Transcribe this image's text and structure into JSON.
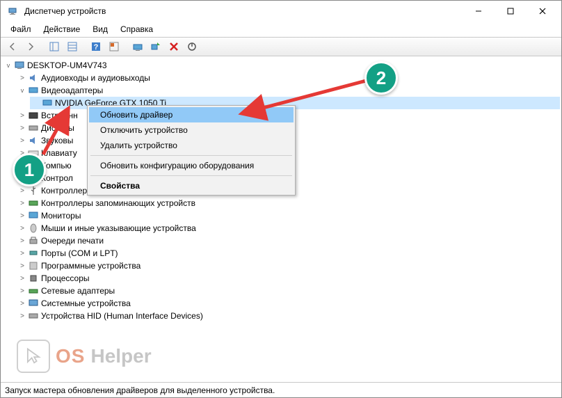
{
  "window": {
    "title": "Диспетчер устройств"
  },
  "menubar": {
    "file": "Файл",
    "action": "Действие",
    "view": "Вид",
    "help": "Справка"
  },
  "tree": {
    "root": "DESKTOP-UM4V743",
    "audio": "Аудиовходы и аудиовыходы",
    "video": "Видеоадаптеры",
    "gpu": "NVIDIA GeForce GTX 1050 Ti",
    "builtin": "Встроенн",
    "disk": "Дисковы",
    "sound": "Звуковы",
    "keyboard": "Клавиату",
    "computer": "Компью",
    "controllers_ide": "Контрол",
    "controllers": "Контроллер",
    "storage_controllers": "Контроллеры запоминающих устройств",
    "monitors": "Мониторы",
    "mice": "Мыши и иные указывающие устройства",
    "print_queues": "Очереди печати",
    "ports": "Порты (COM и LPT)",
    "software_devices": "Программные устройства",
    "processors": "Процессоры",
    "network": "Сетевые адаптеры",
    "system": "Системные устройства",
    "hid": "Устройства HID (Human Interface Devices)"
  },
  "context_menu": {
    "update_driver": "Обновить драйвер",
    "disable": "Отключить устройство",
    "remove": "Удалить устройство",
    "refresh_config": "Обновить конфигурацию оборудования",
    "properties": "Свойства"
  },
  "badges": {
    "one": "1",
    "two": "2"
  },
  "watermark": {
    "os": "OS",
    "helper": "Helper"
  },
  "statusbar": {
    "text": "Запуск мастера обновления драйверов для выделенного устройства."
  }
}
